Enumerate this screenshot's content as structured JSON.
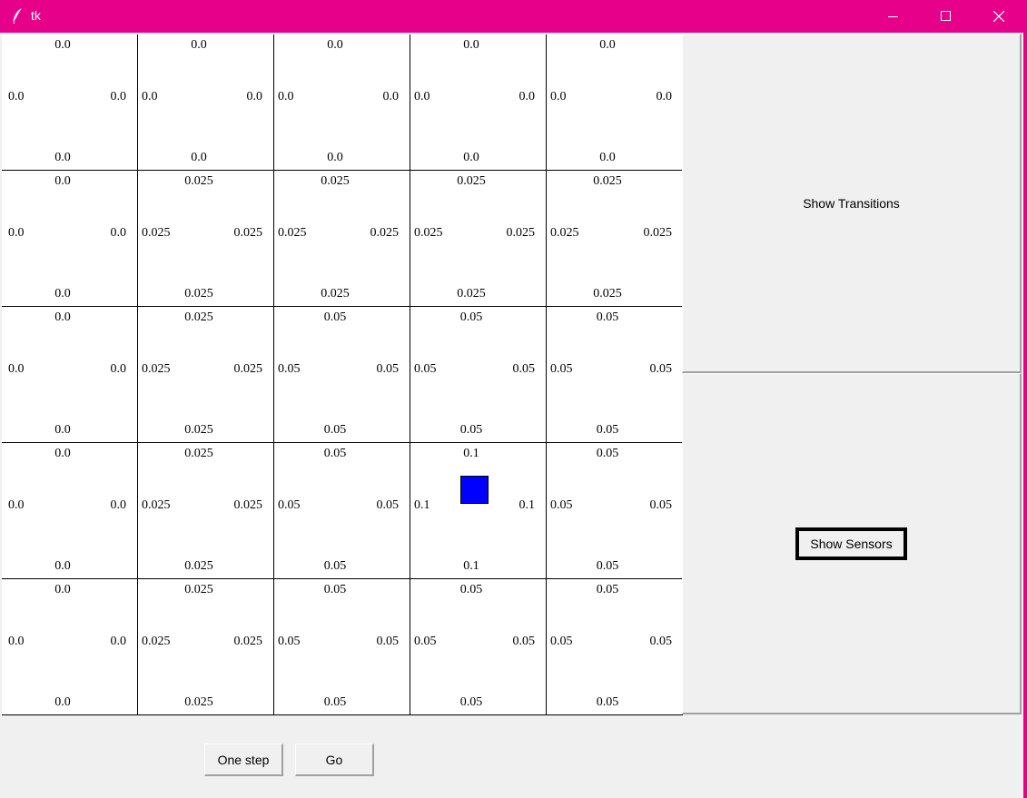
{
  "window": {
    "title": "tk",
    "controls": [
      "minimize",
      "maximize",
      "close"
    ],
    "accent_color": "#e6008a"
  },
  "grid": {
    "rows": [
      [
        {
          "top": "0.0",
          "left": "0.0",
          "right": "0.0",
          "bottom": "0.0"
        },
        {
          "top": "0.0",
          "left": "0.0",
          "right": "0.0",
          "bottom": "0.0"
        },
        {
          "top": "0.0",
          "left": "0.0",
          "right": "0.0",
          "bottom": "0.0"
        },
        {
          "top": "0.0",
          "left": "0.0",
          "right": "0.0",
          "bottom": "0.0"
        },
        {
          "top": "0.0",
          "left": "0.0",
          "right": "0.0",
          "bottom": "0.0"
        }
      ],
      [
        {
          "top": "0.0",
          "left": "0.0",
          "right": "0.0",
          "bottom": "0.0"
        },
        {
          "top": "0.025",
          "left": "0.025",
          "right": "0.025",
          "bottom": "0.025"
        },
        {
          "top": "0.025",
          "left": "0.025",
          "right": "0.025",
          "bottom": "0.025"
        },
        {
          "top": "0.025",
          "left": "0.025",
          "right": "0.025",
          "bottom": "0.025"
        },
        {
          "top": "0.025",
          "left": "0.025",
          "right": "0.025",
          "bottom": "0.025"
        }
      ],
      [
        {
          "top": "0.0",
          "left": "0.0",
          "right": "0.0",
          "bottom": "0.0"
        },
        {
          "top": "0.025",
          "left": "0.025",
          "right": "0.025",
          "bottom": "0.025"
        },
        {
          "top": "0.05",
          "left": "0.05",
          "right": "0.05",
          "bottom": "0.05"
        },
        {
          "top": "0.05",
          "left": "0.05",
          "right": "0.05",
          "bottom": "0.05"
        },
        {
          "top": "0.05",
          "left": "0.05",
          "right": "0.05",
          "bottom": "0.05"
        }
      ],
      [
        {
          "top": "0.0",
          "left": "0.0",
          "right": "0.0",
          "bottom": "0.0"
        },
        {
          "top": "0.025",
          "left": "0.025",
          "right": "0.025",
          "bottom": "0.025"
        },
        {
          "top": "0.05",
          "left": "0.05",
          "right": "0.05",
          "bottom": "0.05"
        },
        {
          "top": "0.1",
          "left": "0.1",
          "right": "0.1",
          "bottom": "0.1",
          "robot": true
        },
        {
          "top": "0.05",
          "left": "0.05",
          "right": "0.05",
          "bottom": "0.05"
        }
      ],
      [
        {
          "top": "0.0",
          "left": "0.0",
          "right": "0.0",
          "bottom": "0.0"
        },
        {
          "top": "0.025",
          "left": "0.025",
          "right": "0.025",
          "bottom": "0.025"
        },
        {
          "top": "0.05",
          "left": "0.05",
          "right": "0.05",
          "bottom": "0.05"
        },
        {
          "top": "0.05",
          "left": "0.05",
          "right": "0.05",
          "bottom": "0.05"
        },
        {
          "top": "0.05",
          "left": "0.05",
          "right": "0.05",
          "bottom": "0.05"
        }
      ]
    ],
    "robot_color": "#0000ff"
  },
  "side": {
    "show_transitions_label": "Show Transitions",
    "show_sensors_label": "Show Sensors"
  },
  "controls": {
    "one_step_label": "One step",
    "go_label": "Go"
  }
}
